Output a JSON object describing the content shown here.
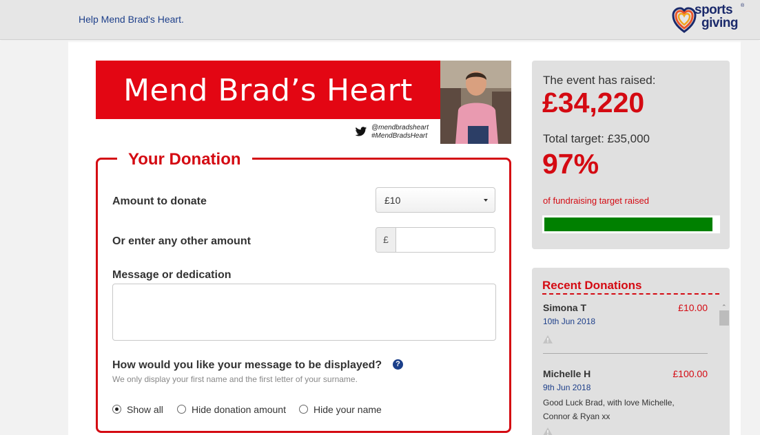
{
  "topbar": {
    "help_link": "Help Mend Brad's Heart."
  },
  "logo": {
    "line1": "sports",
    "line2": "giving",
    "registered": "®"
  },
  "banner": {
    "title": "Mend Brad’s Heart",
    "twitter_handle": "@mendbradsheart",
    "hashtag": "#MendBradsHeart",
    "photo_icon": "person-photo"
  },
  "donation": {
    "heading": "Your Donation",
    "amount_label": "Amount to donate",
    "amount_selected": "£10",
    "other_label": "Or enter any other amount",
    "currency_symbol": "£",
    "other_value": "",
    "message_label": "Message or dedication",
    "message_value": "",
    "display_question": "How would you like your message to be displayed?",
    "help_symbol": "?",
    "display_hint": "We only display your first name and the first letter of your surname.",
    "options": [
      {
        "label": "Show all",
        "selected": true
      },
      {
        "label": "Hide donation amount",
        "selected": false
      },
      {
        "label": "Hide your name",
        "selected": false
      }
    ]
  },
  "raised": {
    "event_label": "The event has raised:",
    "amount": "£34,220",
    "target_label": "Total target: £35,000",
    "percent": "97%",
    "percent_fraction": 0.97,
    "sub": "of fundraising target raised"
  },
  "recent": {
    "heading": "Recent Donations",
    "items": [
      {
        "name": "Simona T",
        "amount": "£10.00",
        "date": "10th Jun 2018",
        "note": ""
      },
      {
        "name": "Michelle H",
        "amount": "£100.00",
        "date": "9th Jun 2018",
        "note": "Good Luck Brad, with love Michelle, Connor & Ryan xx"
      }
    ]
  },
  "colors": {
    "brand_red": "#e30613",
    "accent_red": "#d40a12",
    "progress_green": "#008000",
    "link_blue": "#1d3f8a"
  }
}
